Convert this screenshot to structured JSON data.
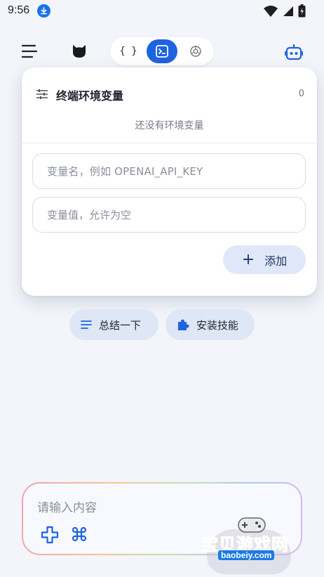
{
  "status_bar": {
    "time": "9:56",
    "icons": [
      "download-icon",
      "wifi-icon",
      "signal-icon",
      "battery-icon"
    ]
  },
  "top_bar": {
    "icons": [
      "menu-icon",
      "cat-icon",
      "robot-icon"
    ],
    "mode_switch": {
      "json_label": "{ }",
      "active": "terminal",
      "icons": [
        "braces-icon",
        "terminal-icon",
        "globe-icon"
      ]
    }
  },
  "panel": {
    "title": "终端环境变量",
    "count": "0",
    "empty_text": "还没有环境变量",
    "name_placeholder": "变量名，例如 OPENAI_API_KEY",
    "value_placeholder": "变量值，允许为空",
    "add_label": "添加",
    "add_icon": "plus-icon",
    "settings_icon": "sliders-icon"
  },
  "chips": [
    {
      "label": "总结一下",
      "icon": "lines-icon"
    },
    {
      "label": "安装技能",
      "icon": "puzzle-icon"
    }
  ],
  "composer": {
    "placeholder": "请输入内容",
    "icons": [
      "plus-outline-icon",
      "command-icon"
    ]
  },
  "watermark": {
    "text": "宝贝游戏网",
    "url": "baobeiy.com"
  },
  "colors": {
    "accent": "#1e63e0",
    "background": "#f3f5fb",
    "chip_bg": "#dfe7f6",
    "watermark_red": "#e0383c"
  }
}
